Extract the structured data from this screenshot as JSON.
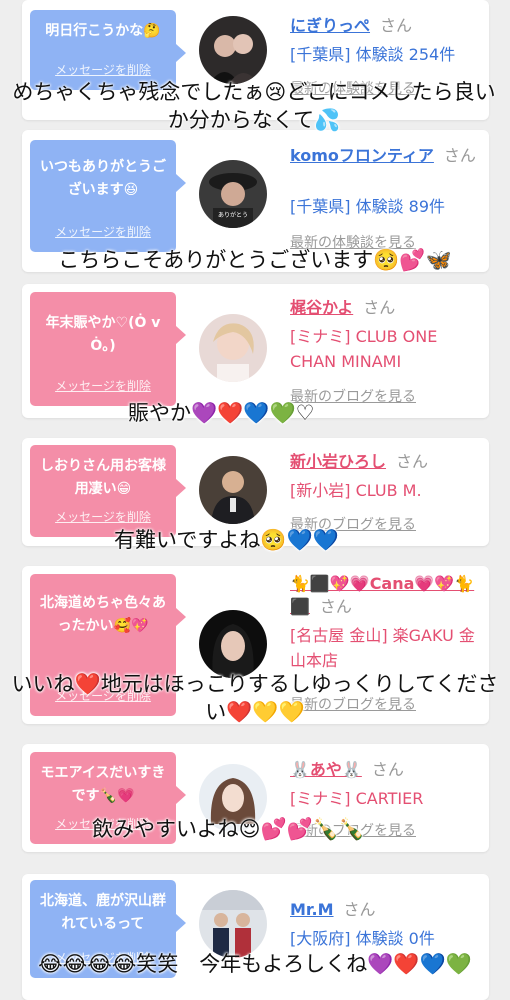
{
  "common": {
    "san": "さん",
    "delete_label": "メッセージを削除"
  },
  "cards": [
    {
      "message": "明日行こうかな🤔",
      "name": "にぎりっぺ",
      "area": "[千葉県] 体験談 254件",
      "more": "最新の体験談を見る"
    },
    {
      "message": "いつもありがとうございます😆",
      "name": "komoフロンティア",
      "area": "[千葉県] 体験談 89件",
      "more": "最新の体験談を見る"
    },
    {
      "message": "年末賑やか♡(Ȯ v Ȯ。)",
      "name": "梶谷かよ",
      "area": "[ミナミ] CLUB ONE CHAN MINAMI",
      "more": "最新のブログを見る"
    },
    {
      "message": "しおりさん用お客様用凄い😁",
      "name": "新小岩ひろし",
      "area": "[新小岩] CLUB M.",
      "more": "最新のブログを見る"
    },
    {
      "message": "北海道めちゃ色々あったかい🥰💖",
      "name": "🐈⬛💖💗Cana💗💖🐈⬛",
      "area": "[名古屋 金山] 楽GAKU 金山本店",
      "more": "最新のブログを見る"
    },
    {
      "message": "モエアイスだいすきです🍾💗",
      "name": "🐰あや🐰",
      "area": "[ミナミ] CARTIER",
      "more": "最新のブログを見る"
    },
    {
      "message": "北海道、鹿が沢山群れているって",
      "name": "Mr.M",
      "area": "[大阪府] 体験談 0件",
      "more": ""
    }
  ],
  "overlays": [
    "めちゃくちゃ残念でしたぁ😢どこにコメしたら良いか分からなくて💦",
    "こちらこそありがとうございます🥺💕🦋",
    "賑やか💜❤️💙💚♡",
    "有難いですよね🥺💙💙",
    "いいね❤️地元はほっこりするしゆっくりしてください❤️💛💛",
    "飲みやすいよね😌💕💕🍾🍾",
    "😂😂😂😂笑笑　今年もよろしくね💜❤️💙💚"
  ]
}
